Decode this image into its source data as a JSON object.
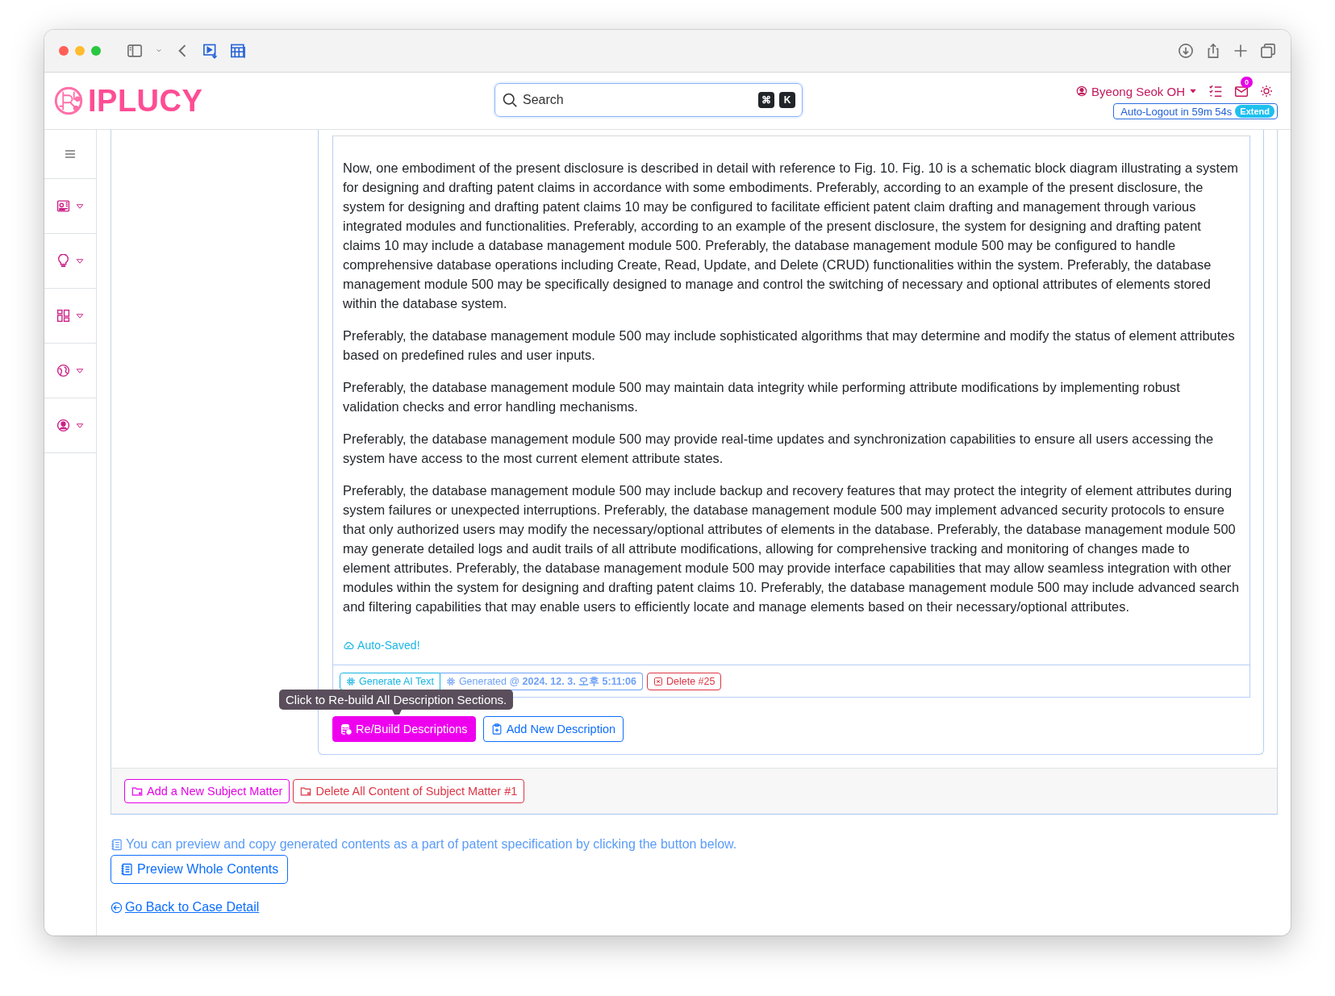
{
  "header": {
    "logo": "IPLUCY",
    "search": {
      "placeholder": "Search",
      "keys": [
        "⌘",
        "K"
      ]
    },
    "user": "Byeong Seok OH",
    "mail_count": "0",
    "auto_logout": "Auto-Logout in 59m 54s",
    "extend": "Extend"
  },
  "description": {
    "paragraphs": [
      "Now, one embodiment of the present disclosure is described in detail with reference to Fig. 10. Fig. 10 is a schematic block diagram illustrating a system for designing and drafting patent claims in accordance with some embodiments. Preferably, according to an example of the present disclosure, the system for designing and drafting patent claims 10 may be configured to facilitate efficient patent claim drafting and management through various integrated modules and functionalities. Preferably, according to an example of the present disclosure, the system for designing and drafting patent claims 10 may include a database management module 500. Preferably, the database management module 500 may be configured to handle comprehensive database operations including Create, Read, Update, and Delete (CRUD) functionalities within the system. Preferably, the database management module 500 may be specifically designed to manage and control the switching of necessary and optional attributes of elements stored within the database system.",
      "Preferably, the database management module 500 may include sophisticated algorithms that may determine and modify the status of element attributes based on predefined rules and user inputs.",
      "Preferably, the database management module 500 may maintain data integrity while performing attribute modifications by implementing robust validation checks and error handling mechanisms.",
      "Preferably, the database management module 500 may provide real-time updates and synchronization capabilities to ensure all users accessing the system have access to the most current element attribute states.",
      "Preferably, the database management module 500 may include backup and recovery features that may protect the integrity of element attributes during system failures or unexpected interruptions. Preferably, the database management module 500 may implement advanced security protocols to ensure that only authorized users may modify the necessary/optional attributes of elements in the database. Preferably, the database management module 500 may generate detailed logs and audit trails of all attribute modifications, allowing for comprehensive tracking and monitoring of changes made to element attributes. Preferably, the database management module 500 may provide interface capabilities that may allow seamless integration with other modules within the system for designing and drafting patent claims 10. Preferably, the database management module 500 may include advanced search and filtering capabilities that may enable users to efficiently locate and manage elements based on their necessary/optional attributes."
    ],
    "status": "Auto-Saved!",
    "actions": [
      {
        "kind": "generate",
        "label": "Generate AI Text"
      },
      {
        "kind": "generated",
        "label": "Generated @ **2024. 12. 3. 오후 5:11:06**"
      },
      {
        "kind": "delete",
        "label": "Delete #25"
      }
    ]
  },
  "tooltip": "Click to Re-build All Description Sections.",
  "card_buttons": [
    {
      "kind": "rebuild",
      "label": "Re/Build Descriptions"
    },
    {
      "kind": "add",
      "label": "Add New Description"
    }
  ],
  "subject_buttons": [
    {
      "kind": "add",
      "label": "Add a New Subject Matter"
    },
    {
      "kind": "delete",
      "label": "Delete All Content of Subject Matter #1"
    }
  ],
  "preview_hint": "You can preview and copy generated contents as a part of patent specification by clicking the button below.",
  "preview_button": "Preview Whole Contents",
  "back_link": "Go Back to Case Detail"
}
